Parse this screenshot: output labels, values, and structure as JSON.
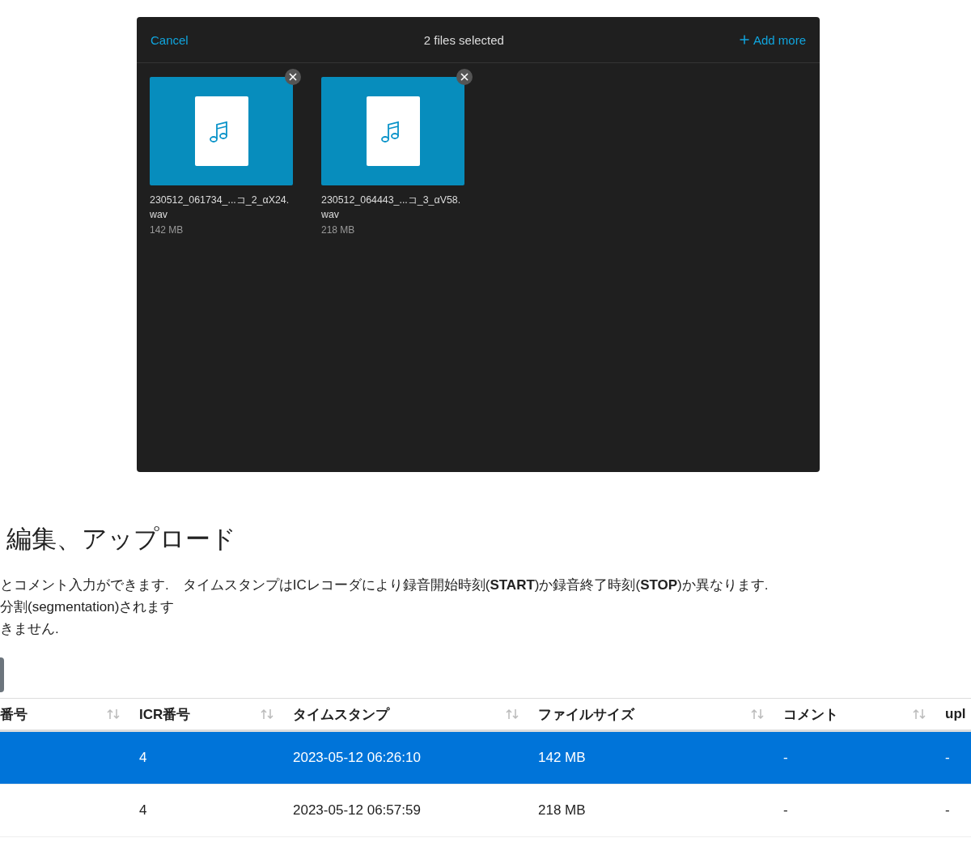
{
  "dialog": {
    "cancel": "Cancel",
    "title": "2 files selected",
    "add_more": "Add more",
    "files": [
      {
        "name": "230512_061734_...コ_2_αX24.wav",
        "size": "142 MB"
      },
      {
        "name": "230512_064443_...コ_3_αV58.wav",
        "size": "218 MB"
      }
    ]
  },
  "heading": "編集、アップロード",
  "notes": [
    "とコメント入力ができます.　タイムスタンプはICレコーダにより録音開始時刻(**START**)か録音終了時刻(**STOP**)か異なります.",
    "分割(segmentation)されます",
    "きません."
  ],
  "table": {
    "columns": [
      "番号",
      "ICR番号",
      "タイムスタンプ",
      "ファイルサイズ",
      "コメント",
      "upl"
    ],
    "rows": [
      {
        "selected": true,
        "cells": [
          "",
          "4",
          "2023-05-12 06:26:10",
          "142 MB",
          "-",
          "-"
        ]
      },
      {
        "selected": false,
        "cells": [
          "",
          "4",
          "2023-05-12 06:57:59",
          "218 MB",
          "-",
          "-"
        ]
      }
    ]
  }
}
